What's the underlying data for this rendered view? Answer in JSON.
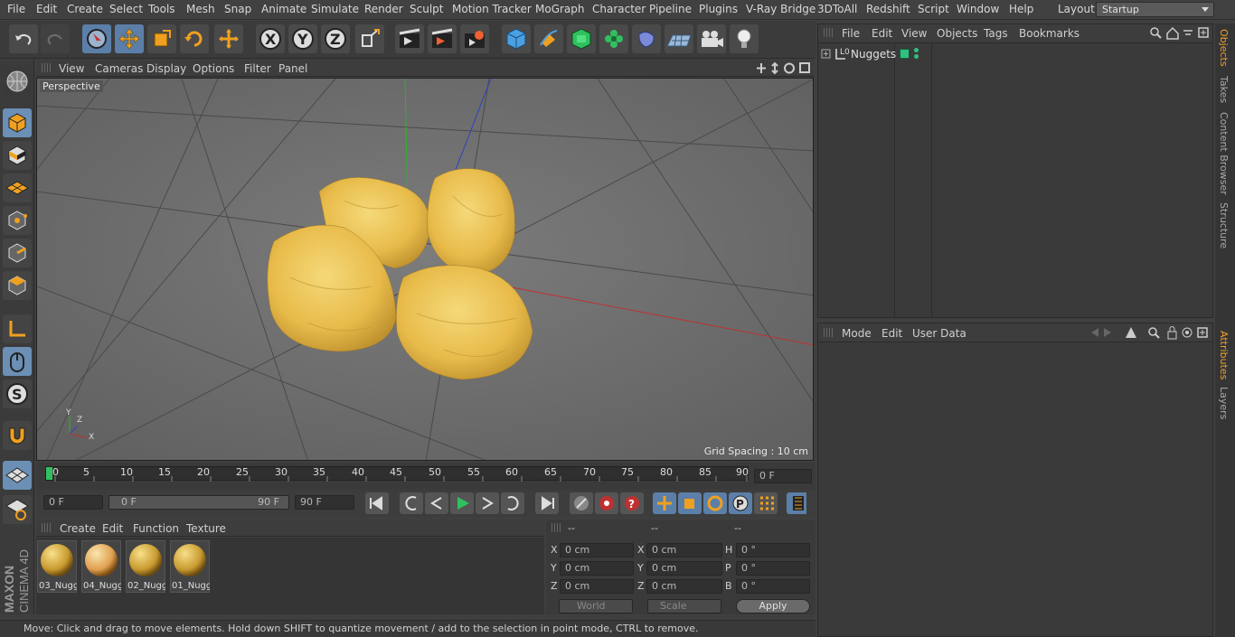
{
  "menubar": {
    "items": [
      "File",
      "Edit",
      "Create",
      "Select",
      "Tools",
      "Mesh",
      "Snap",
      "Animate",
      "Simulate",
      "Render",
      "Sculpt",
      "Motion Tracker",
      "MoGraph",
      "Character",
      "Pipeline",
      "Plugins",
      "V-Ray Bridge",
      "3DToAll",
      "Redshift",
      "Script",
      "Window",
      "Help"
    ],
    "layout_label": "Layout:",
    "layout_value": "Startup"
  },
  "toolbar": {
    "icons": [
      "undo-icon",
      "redo-icon",
      "select-cursor-icon",
      "move-icon",
      "scale-icon",
      "rotate-icon",
      "live-selection-icon",
      "x-axis-icon",
      "y-axis-icon",
      "z-axis-icon",
      "coordinate-system-icon",
      "render-view-icon",
      "render-picture-viewer-icon",
      "render-settings-icon",
      "cube-icon",
      "pen-icon",
      "subdivision-icon",
      "cloner-icon",
      "deformer-icon",
      "floor-icon",
      "camera-icon",
      "light-icon"
    ]
  },
  "viewport": {
    "menu": [
      "View",
      "Cameras",
      "Display",
      "Options",
      "Filter",
      "Panel"
    ],
    "camera_label": "Perspective",
    "grid_spacing": "Grid Spacing : 10 cm",
    "axis_labels": {
      "x": "X",
      "y": "Y",
      "z": "Z"
    }
  },
  "timeline": {
    "ticks": [
      "0",
      "5",
      "10",
      "15",
      "20",
      "25",
      "30",
      "35",
      "40",
      "45",
      "50",
      "55",
      "60",
      "65",
      "70",
      "75",
      "80",
      "85",
      "90"
    ],
    "current_frame": "0 F"
  },
  "transport": {
    "start_field": "0 F",
    "range_start": "0 F",
    "range_end": "90 F",
    "end_field": "90 F"
  },
  "materials": {
    "menu": [
      "Create",
      "Edit",
      "Function",
      "Texture"
    ],
    "items": [
      "03_Nugg",
      "04_Nugg",
      "02_Nugg",
      "01_Nugg"
    ]
  },
  "coords": {
    "headers": [
      "--",
      "--",
      "--"
    ],
    "rows": [
      {
        "a": "X",
        "av": "0 cm",
        "b": "X",
        "bv": "0 cm",
        "c": "H",
        "cv": "0 °"
      },
      {
        "a": "Y",
        "av": "0 cm",
        "b": "Y",
        "bv": "0 cm",
        "c": "P",
        "cv": "0 °"
      },
      {
        "a": "Z",
        "av": "0 cm",
        "b": "Z",
        "bv": "0 cm",
        "c": "B",
        "cv": "0 °"
      }
    ],
    "world": "World",
    "scale": "Scale",
    "apply": "Apply"
  },
  "status": "Move: Click and drag to move elements. Hold down SHIFT to quantize movement / add to the selection in point mode, CTRL to remove.",
  "objects": {
    "menu": [
      "File",
      "Edit",
      "View",
      "Objects",
      "Tags",
      "Bookmarks"
    ],
    "tree": [
      {
        "name": "Nuggets",
        "layer": "L0"
      }
    ]
  },
  "attributes": {
    "menu": [
      "Mode",
      "Edit",
      "User Data"
    ]
  },
  "side_tabs": [
    "Objects",
    "Takes",
    "Content Browser",
    "Structure",
    "Attributes",
    "Layers"
  ],
  "brand": {
    "line1": "MAXON",
    "line2": "CINEMA 4D"
  },
  "colors": {
    "accent": "#5b7fa8",
    "nugget": "#e6b84a",
    "active_tab": "#f0a030",
    "x_axis": "#c03030",
    "y_axis": "#30a030",
    "z_axis": "#3040c0"
  }
}
